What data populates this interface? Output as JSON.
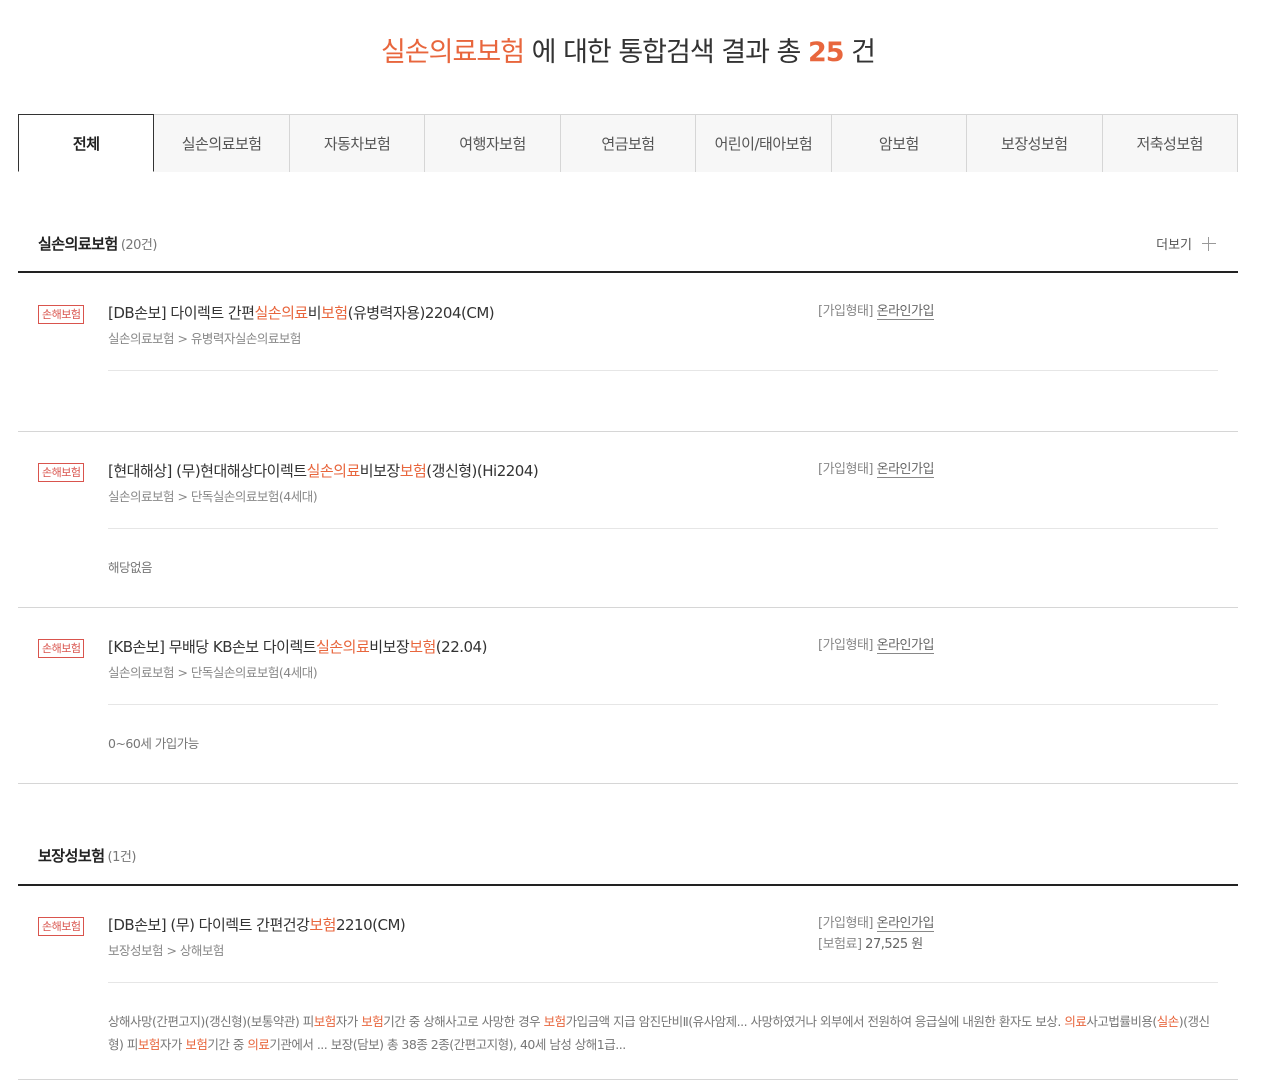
{
  "headline": {
    "keyword": "실손의료보험",
    "middle": "에 대한 통합검색 결과 총",
    "count": "25",
    "suffix": "건"
  },
  "tabs": [
    "전체",
    "실손의료보험",
    "자동차보험",
    "여행자보험",
    "연금보험",
    "어린이/태아보험",
    "암보험",
    "보장성보험",
    "저축성보험"
  ],
  "sections": [
    {
      "title": "실손의료보험",
      "count": "(20건)",
      "more_label": "더보기",
      "items": [
        {
          "badge": "손해보험",
          "title_parts": [
            "[DB손보]  다이렉트 간편",
            "실손의료",
            "비",
            "보험",
            "(유병력자용)2204(CM)"
          ],
          "breadcrumb": "실손의료보험 > 유병력자실손의료보험",
          "join_label": "[가입형태]",
          "join_value": "온라인가입",
          "desc": ""
        },
        {
          "badge": "손해보험",
          "title_parts": [
            "[현대해상]  (무)현대해상다이렉트",
            "실손의료",
            "비보장",
            "보험",
            "(갱신형)(Hi2204)"
          ],
          "breadcrumb": "실손의료보험 > 단독실손의료보험(4세대)",
          "join_label": "[가입형태]",
          "join_value": "온라인가입",
          "desc": "해당없음"
        },
        {
          "badge": "손해보험",
          "title_parts": [
            "[KB손보]  무배당 KB손보 다이렉트",
            "실손의료",
            "비보장",
            "보험",
            "(22.04)"
          ],
          "breadcrumb": "실손의료보험 > 단독실손의료보험(4세대)",
          "join_label": "[가입형태]",
          "join_value": "온라인가입",
          "desc": "0~60세 가입가능"
        }
      ]
    },
    {
      "title": "보장성보험",
      "count": "(1건)",
      "items": [
        {
          "badge": "손해보험",
          "title_parts": [
            "[DB손보]  (무) 다이렉트 간편건강",
            "보험",
            "2210(CM)"
          ],
          "breadcrumb": "보장성보험 > 상해보험",
          "join_label": "[가입형태]",
          "join_value": "온라인가입",
          "premium_label": "[보험료]",
          "premium_value": "27,525 원",
          "desc_parts": [
            "상해사망(간편고지)(갱신형)(보통약관) 피",
            "보험",
            "자가 ",
            "보험",
            "기간 중 상해사고로 사망한 경우 ",
            "보험",
            "가입금액 지급 암진단비Ⅱ(유사암제... 사망하였거나 외부에서 전원하여 응급실에 내원한 환자도 보상. ",
            "의료",
            "사고법률비용(",
            "실손",
            ")(갱신형) 피",
            "보험",
            "자가 ",
            "보험",
            "기간 중 ",
            "의료",
            "기관에서 ... 보장(담보) 총 38종 2종(간편고지형), 40세 남성 상해1급..."
          ]
        }
      ]
    }
  ]
}
